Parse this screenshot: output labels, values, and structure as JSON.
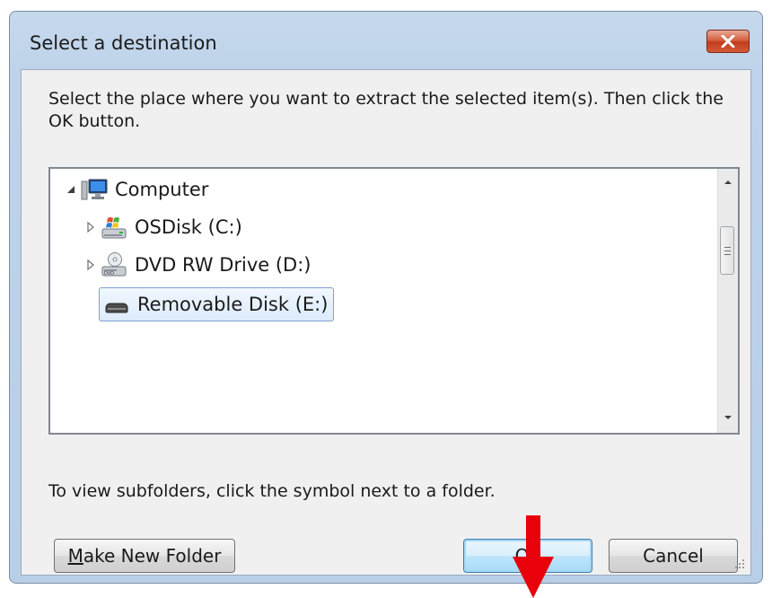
{
  "dialog": {
    "title": "Select a destination",
    "close_icon": "close-x-icon"
  },
  "instruction": "Select the place where you want to extract the selected item(s).  Then click the OK button.",
  "tree": {
    "items": [
      {
        "label": "Computer",
        "icon": "computer-icon",
        "expander": "expanded-triangle-icon",
        "selected": false
      },
      {
        "label": "OSDisk (C:)",
        "icon": "windows-drive-icon",
        "expander": "collapsed-triangle-icon",
        "selected": false
      },
      {
        "label": "DVD RW Drive (D:)",
        "icon": "dvd-drive-icon",
        "expander": "collapsed-triangle-icon",
        "selected": false
      },
      {
        "label": "Removable Disk (E:)",
        "icon": "removable-disk-icon",
        "expander": "",
        "selected": true
      }
    ]
  },
  "hint": "To view subfolders, click the symbol next to a folder.",
  "buttons": {
    "make_new_folder_mnemonic": "M",
    "make_new_folder_rest": "ake New Folder",
    "ok": "OK",
    "cancel": "Cancel"
  },
  "annotation": {
    "icon": "red-down-arrow-icon",
    "color": "#e8000b"
  }
}
